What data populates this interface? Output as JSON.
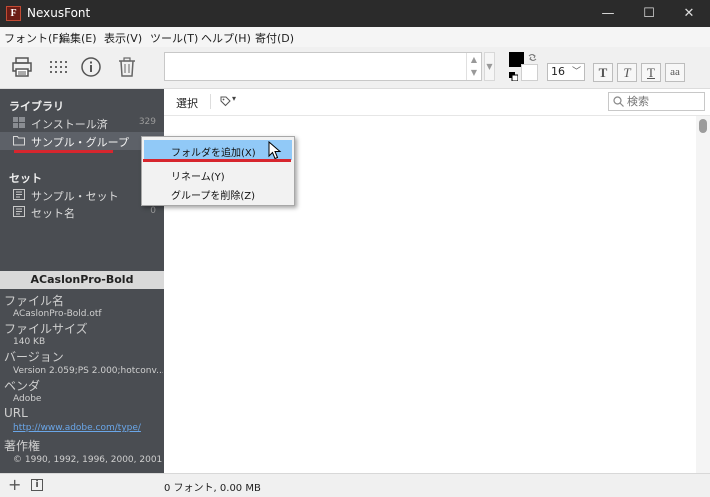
{
  "window": {
    "title": "NexusFont",
    "app_icon_letter": "F"
  },
  "menu": [
    "フォント(F)",
    "編集(E)",
    "表示(V)",
    "ツール(T)",
    "ヘルプ(H)",
    "寄付(D)"
  ],
  "toolbar": {
    "font_size": "16",
    "style_labels": [
      "T",
      "T",
      "T",
      "aa"
    ],
    "fg_color": "#000000",
    "bg_color": "#ffffff"
  },
  "sidebar": {
    "library_header": "ライブラリ",
    "library_items": [
      {
        "label": "インストール済",
        "count": "329",
        "icon": "windows-icon"
      },
      {
        "label": "サンプル・グループ",
        "count": "",
        "icon": "folder-icon"
      }
    ],
    "set_header": "セット",
    "set_items": [
      {
        "label": "サンプル・セット",
        "count": "",
        "icon": "set-icon"
      },
      {
        "label": "セット名",
        "count": "0",
        "icon": "set-icon"
      }
    ]
  },
  "font_info": {
    "name": "ACaslonPro-Bold",
    "file_name_label": "ファイル名",
    "file_name": "ACaslonPro-Bold.otf",
    "file_size_label": "ファイルサイズ",
    "file_size": "140 KB",
    "version_label": "バージョン",
    "version": "Version 2.059;PS 2.000;hotconv...",
    "vendor_label": "ベンダ",
    "vendor": "Adobe",
    "url_label": "URL",
    "url": "http://www.adobe.com/type/",
    "copyright_label": "著作権",
    "copyright": "© 1990, 1992, 1996, 2000, 2001 ..."
  },
  "content": {
    "select_label": "選択",
    "tag_label": "▾",
    "search_placeholder": "検索"
  },
  "status": {
    "text": "0 フォント, 0.00 MB"
  },
  "context_menu": [
    {
      "label": "フォルダを追加(X)",
      "highlighted": true
    },
    {
      "label": "リネーム(Y)",
      "highlighted": false
    },
    {
      "label": "グループを削除(Z)",
      "highlighted": false
    }
  ],
  "colors": {
    "sidebar_bg": "#4a4d52",
    "titlebar_bg": "#2b2b2b",
    "highlight": "#91c9f7",
    "annotation_red": "#d7262e",
    "link": "#6aa6e8"
  }
}
